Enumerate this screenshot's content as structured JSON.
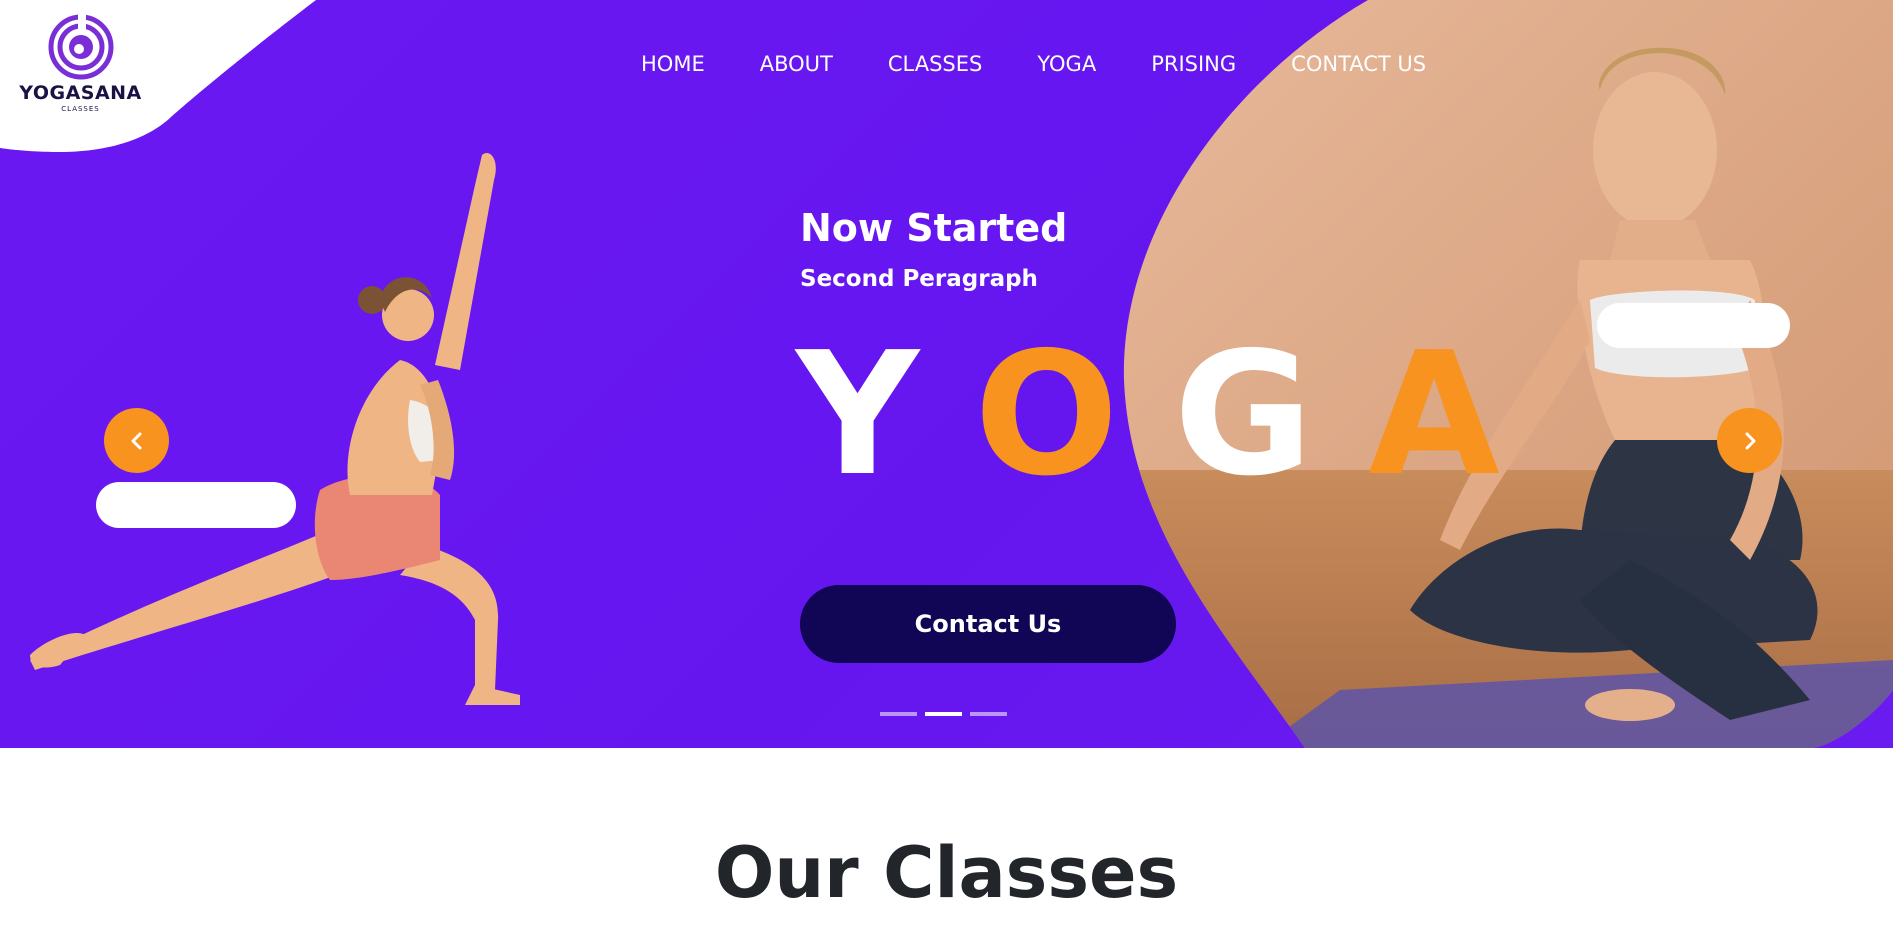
{
  "brand": {
    "name": "YOGASANA",
    "tagline": "CLASSES"
  },
  "nav": {
    "items": [
      {
        "label": "HOME"
      },
      {
        "label": "ABOUT"
      },
      {
        "label": "CLASSES"
      },
      {
        "label": "YOGA"
      },
      {
        "label": "PRISING"
      },
      {
        "label": "CONTACT US"
      }
    ]
  },
  "hero": {
    "headline": "Now Started",
    "subheadline": "Second Peragraph",
    "big_word_letters": [
      "Y",
      "O",
      "G",
      "A"
    ],
    "cta_label": "Contact Us",
    "slide_count": 3,
    "active_slide": 2
  },
  "colors": {
    "hero_bg": "#6516ef",
    "accent": "#f7931e",
    "cta_bg": "#110655",
    "letter_white": "#ffffff",
    "letter_orange": "#f7931e"
  },
  "icons": {
    "prev": "chevron-left-icon",
    "next": "chevron-right-icon",
    "logo": "yogasana-logo-icon"
  },
  "section": {
    "title": "Our Classes"
  }
}
